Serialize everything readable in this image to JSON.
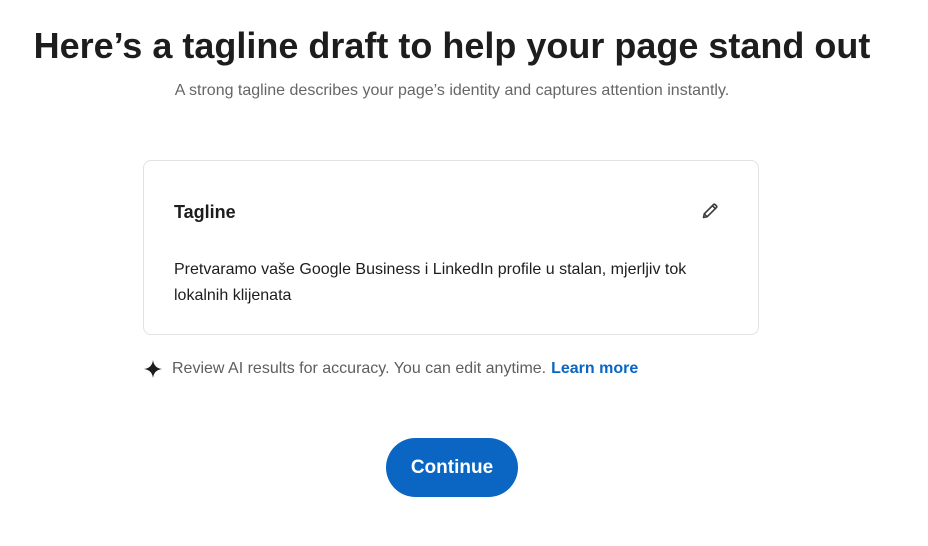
{
  "header": {
    "title": "Here’s a tagline draft to help your page stand out",
    "subtitle": "A strong tagline describes your page’s identity and captures attention instantly."
  },
  "card": {
    "title": "Tagline",
    "text": "Pretvaramo vaše Google Business i LinkedIn profile u stalan, mjerljiv tok lokalnih klijenata",
    "edit_icon": "pencil-icon"
  },
  "notice": {
    "icon": "sparkle-icon",
    "text": "Review AI results for accuracy. You can edit anytime.",
    "link_label": "Learn more"
  },
  "actions": {
    "continue_label": "Continue"
  },
  "colors": {
    "accent": "#0a66c2",
    "text": "#1d1d1d",
    "muted": "#666666",
    "border": "#e2e2e2"
  }
}
